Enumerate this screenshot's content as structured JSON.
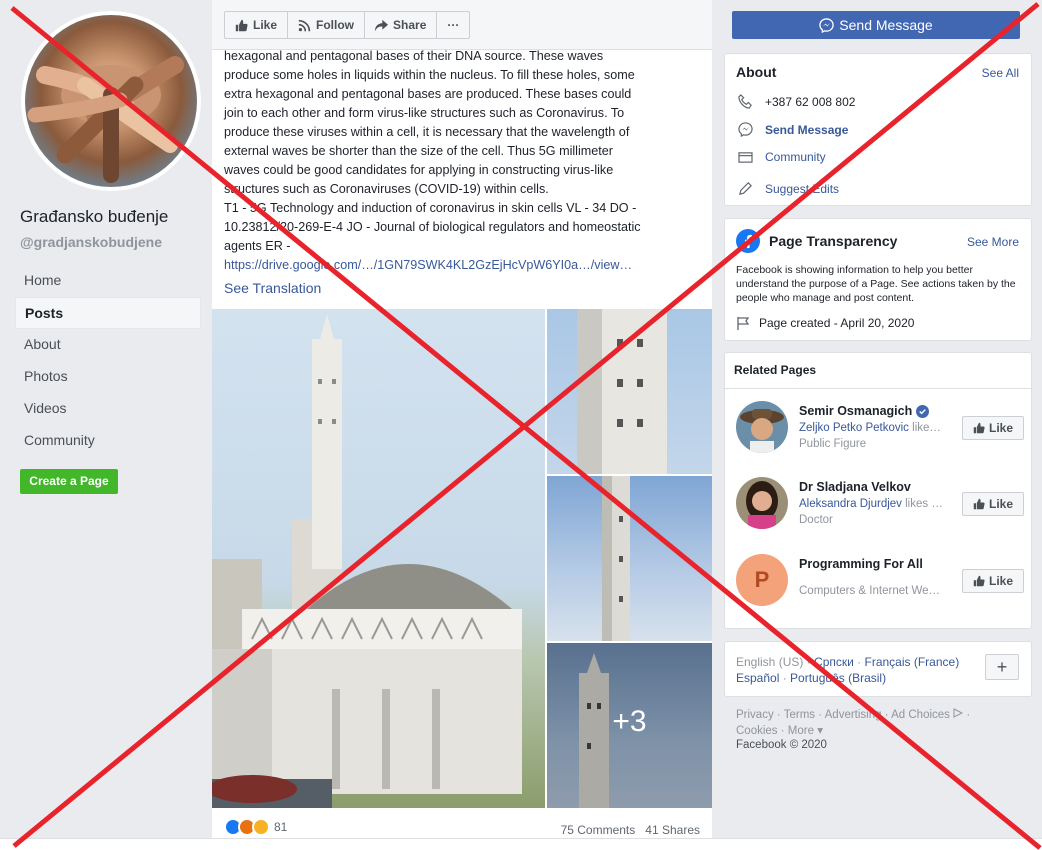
{
  "page": {
    "name": "Građansko buđenje",
    "handle": "@gradjanskobudjene"
  },
  "nav": {
    "items": [
      "Home",
      "Posts",
      "About",
      "Photos",
      "Videos",
      "Community"
    ],
    "active": "Posts",
    "create_page": "Create a Page"
  },
  "actions": {
    "like": "Like",
    "follow": "Follow",
    "share": "Share",
    "more": "···",
    "send_message": "Send Message"
  },
  "post": {
    "lines": [
      "hexagonal and pentagonal bases of their DNA source. These waves",
      "produce some holes in liquids within the nucleus. To fill these holes, some",
      "extra hexagonal and pentagonal bases are produced. These bases could",
      "join to each other and form virus-like structures such as Coronavirus. To",
      "produce these viruses within a cell, it is necessary that the wavelength of",
      "external waves be shorter than the size of the cell. Thus 5G millimeter",
      "waves could be good candidates for applying in constructing virus-like",
      "structures such as Coronaviruses (COVID-19) within cells.",
      "T1 - 5G Technology and induction of coronavirus in skin cells VL - 34 DO -",
      "10.23812/20-269-E-4 JO - Journal of biological regulators and homeostatic",
      "agents ER -"
    ],
    "link": "https://drive.google.com/…/1GN79SWK4KL2GzEjHcVpW6YI0a…/view…",
    "see_translation": "See Translation",
    "more_photos": "+3",
    "reaction_count": "81",
    "comments": "75 Comments",
    "shares": "41 Shares"
  },
  "about": {
    "title": "About",
    "see_all": "See All",
    "phone": "+387 62 008 802",
    "send_message": "Send Message",
    "community": "Community",
    "suggest_edits": "Suggest Edits"
  },
  "transparency": {
    "title": "Page Transparency",
    "see_more": "See More",
    "text": "Facebook is showing information to help you better understand the purpose of a Page. See actions taken by the people who manage and post content.",
    "page_created": "Page created - April 20, 2020"
  },
  "related": {
    "title": "Related Pages",
    "items": [
      {
        "name": "Semir Osmanagich",
        "liker": "Zeljko Petko Petkovic",
        "likes_suffix": " like…",
        "category": "Public Figure",
        "like": "Like"
      },
      {
        "name": "Dr Sladjana Velkov",
        "liker": "Aleksandra Djurdjev",
        "likes_suffix": " likes …",
        "category": "Doctor",
        "like": "Like"
      },
      {
        "name": "Programming For All",
        "liker": "",
        "likes_suffix": "",
        "category": "Computers & Internet We…",
        "like": "Like",
        "initial": "P"
      }
    ]
  },
  "languages": {
    "current": "English (US)",
    "others": [
      "Српски",
      "Français (France)",
      "Español",
      "Português (Brasil)"
    ],
    "add": "+"
  },
  "footer": {
    "links": [
      "Privacy",
      "Terms",
      "Advertising",
      "Ad Choices",
      "Cookies",
      "More"
    ],
    "copyright": "Facebook © 2020"
  },
  "colors": {
    "fb_blue": "#4267b2",
    "link": "#385898",
    "green": "#42b72a",
    "red_x": "#e8232b"
  }
}
